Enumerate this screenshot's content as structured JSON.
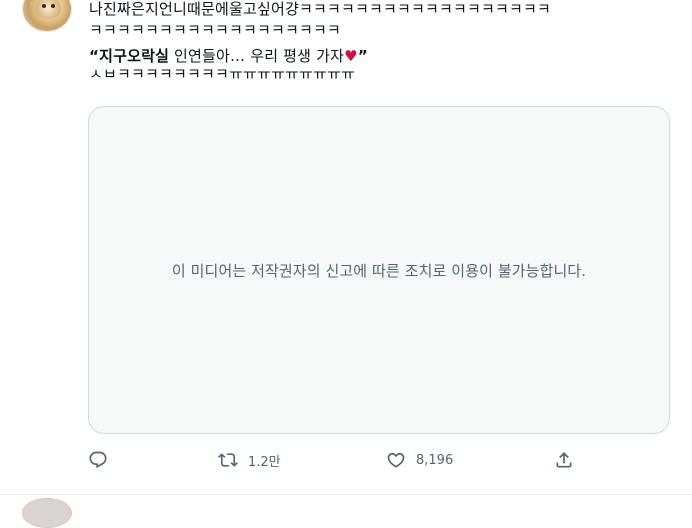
{
  "tweet": {
    "text_line1": "나진짜은지언니때문에울고싶어걍ㅋㅋㅋㅋㅋㅋㅋㅋㅋㅋㅋㅋㅋㅋㅋㅋㅋㅋ",
    "text_line2": "ㅋㅋㅋㅋㅋㅋㅋㅋㅋㅋㅋㅋㅋㅋㅋㅋㅋㅋ",
    "quote_open": "“",
    "quote_bold": "지구오락실",
    "quote_rest": " 인연들아… 우리 평생 가자",
    "quote_heart": "♥",
    "quote_close": "”",
    "text_line4": "ㅅㅂㅋㅋㅋㅋㅋㅋㅋㅋㅠㅠㅠㅠㅠㅠㅠㅠㅠ"
  },
  "media": {
    "unavailable_message": "이 미디어는 저작권자의 신고에 따른 조치로 이용이 불가능합니다."
  },
  "actions": {
    "reply_icon": "reply-icon",
    "retweet_icon": "retweet-icon",
    "retweet_count": "1.2만",
    "like_icon": "heart-icon",
    "like_count": "8,196",
    "share_icon": "share-icon"
  },
  "colors": {
    "text_primary": "#0f1419",
    "text_secondary": "#536471",
    "media_border": "#cfd9de",
    "media_background": "#f7f9f9",
    "heart_emoji": "#d0103a"
  }
}
